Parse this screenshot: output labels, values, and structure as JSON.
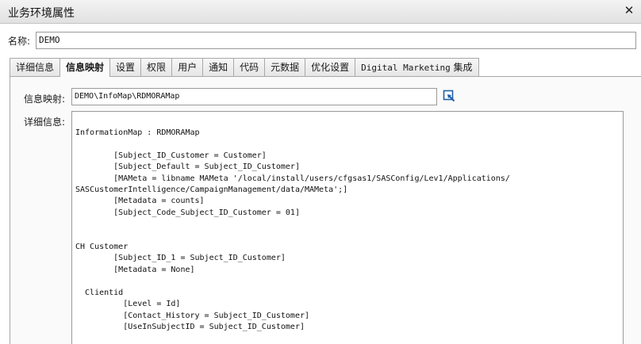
{
  "window": {
    "title": "业务环境属性",
    "close_glyph": "✕"
  },
  "name_field": {
    "label": "名称:",
    "value": "DEMO"
  },
  "tabs": [
    {
      "label": "详细信息",
      "active": false
    },
    {
      "label": "信息映射",
      "active": true
    },
    {
      "label": "设置",
      "active": false
    },
    {
      "label": "权限",
      "active": false
    },
    {
      "label": "用户",
      "active": false
    },
    {
      "label": "通知",
      "active": false
    },
    {
      "label": "代码",
      "active": false
    },
    {
      "label": "元数据",
      "active": false
    },
    {
      "label": "优化设置",
      "active": false
    },
    {
      "label_latin": "Digital Marketing",
      "label_cjk": " 集成",
      "active": false
    }
  ],
  "info_map": {
    "label": "信息映射:",
    "value": "DEMO\\InfoMap\\RDMORAMap",
    "browse_icon": "browse-icon"
  },
  "details": {
    "label": "详细信息:",
    "text": "InformationMap : RDMORAMap\n\n        [Subject_ID_Customer = Customer]\n        [Subject_Default = Subject_ID_Customer]\n        [MAMeta = libname MAMeta '/local/install/users/cfgsas1/SASConfig/Lev1/Applications/\nSASCustomerIntelligence/CampaignManagement/data/MAMeta';]\n        [Metadata = counts]\n        [Subject_Code_Subject_ID_Customer = 01]\n\n\nCH Customer\n        [Subject_ID_1 = Subject_ID_Customer]\n        [Metadata = None]\n\n  Clientid\n          [Level = Id]\n          [Contact_History = Subject_ID_Customer]\n          [UseInSubjectID = Subject_ID_Customer]"
  },
  "colors": {
    "titlebar": "#e8e8e8",
    "panel": "#fafafa",
    "browse_icon_accent": "#1f5fa8"
  }
}
